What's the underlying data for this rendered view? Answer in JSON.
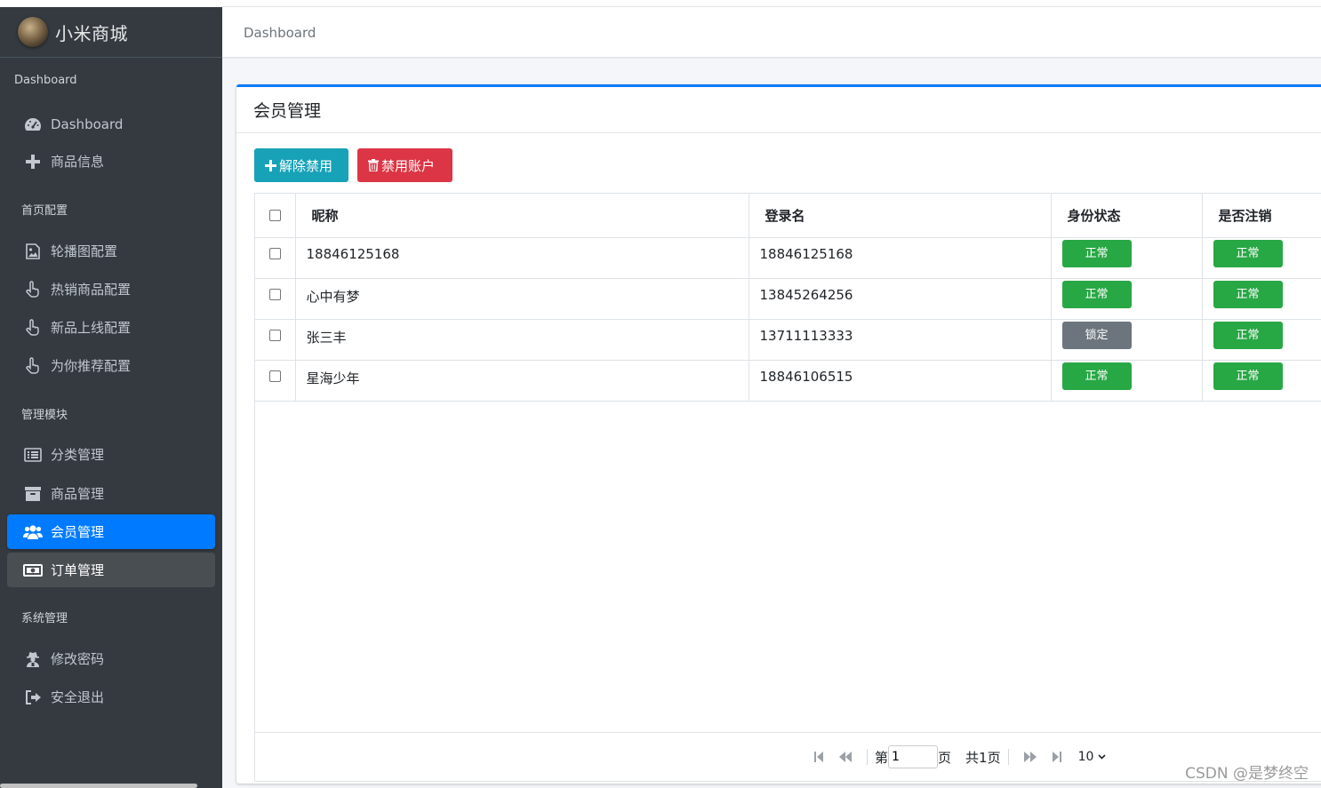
{
  "brand": {
    "name": "小米商城"
  },
  "breadcrumb": "Dashboard",
  "sidebar": {
    "sections": [
      {
        "header": "Dashboard",
        "items": [
          {
            "label": "Dashboard",
            "icon": "tachometer-icon"
          },
          {
            "label": "商品信息",
            "icon": "plus-icon"
          }
        ]
      },
      {
        "header": "首页配置",
        "items": [
          {
            "label": "轮播图配置",
            "icon": "image-icon"
          },
          {
            "label": "热销商品配置",
            "icon": "hand-pointer-icon"
          },
          {
            "label": "新品上线配置",
            "icon": "hand-pointer-icon"
          },
          {
            "label": "为你推荐配置",
            "icon": "hand-pointer-icon"
          }
        ]
      },
      {
        "header": "管理模块",
        "items": [
          {
            "label": "分类管理",
            "icon": "list-icon"
          },
          {
            "label": "商品管理",
            "icon": "archive-icon"
          },
          {
            "label": "会员管理",
            "icon": "users-icon",
            "active": true
          },
          {
            "label": "订单管理",
            "icon": "money-bill-icon",
            "hover": true
          }
        ]
      },
      {
        "header": "系统管理",
        "items": [
          {
            "label": "修改密码",
            "icon": "user-secret-icon"
          },
          {
            "label": "安全退出",
            "icon": "sign-out-icon"
          }
        ]
      }
    ]
  },
  "card": {
    "title": "会员管理"
  },
  "toolbar": {
    "unban_label": "解除禁用",
    "ban_label": "禁用账户"
  },
  "table": {
    "columns": [
      "昵称",
      "登录名",
      "身份状态",
      "是否注销"
    ],
    "rows": [
      {
        "nickname": "18846125168",
        "login": "18846125168",
        "status": "正常",
        "deleted": "正常"
      },
      {
        "nickname": "心中有梦",
        "login": "13845264256",
        "status": "正常",
        "deleted": "正常"
      },
      {
        "nickname": "张三丰",
        "login": "13711113333",
        "status": "锁定",
        "deleted": "正常"
      },
      {
        "nickname": "星海少年",
        "login": "18846106515",
        "status": "正常",
        "deleted": "正常"
      }
    ]
  },
  "pager": {
    "page_prefix": "第",
    "page_value": "1",
    "page_suffix": "页",
    "total": "共1页",
    "page_size": "10"
  },
  "watermark": "CSDN @是梦终空",
  "colors": {
    "sidebar_bg": "#343a40",
    "primary": "#007bff",
    "info": "#17a2b8",
    "danger": "#dc3545",
    "success": "#28a745",
    "secondary": "#6c757d"
  }
}
